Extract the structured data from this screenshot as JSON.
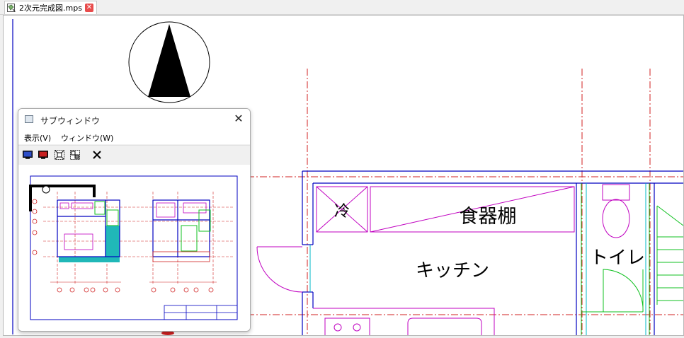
{
  "tab": {
    "title": "2次元完成図.mps"
  },
  "rooms": {
    "fridge": "冷",
    "shelf": "食器棚",
    "kitchen": "キッチン",
    "toilet": "トイレ"
  },
  "subwindow": {
    "title": "サブウィンドウ",
    "menu": [
      "表示(V)",
      "ウィンドウ(W)"
    ],
    "toolbar": [
      "monitor-blue-icon",
      "monitor-red-icon",
      "zoom-fit-icon",
      "zoom-area-icon",
      "close-x-icon"
    ]
  }
}
